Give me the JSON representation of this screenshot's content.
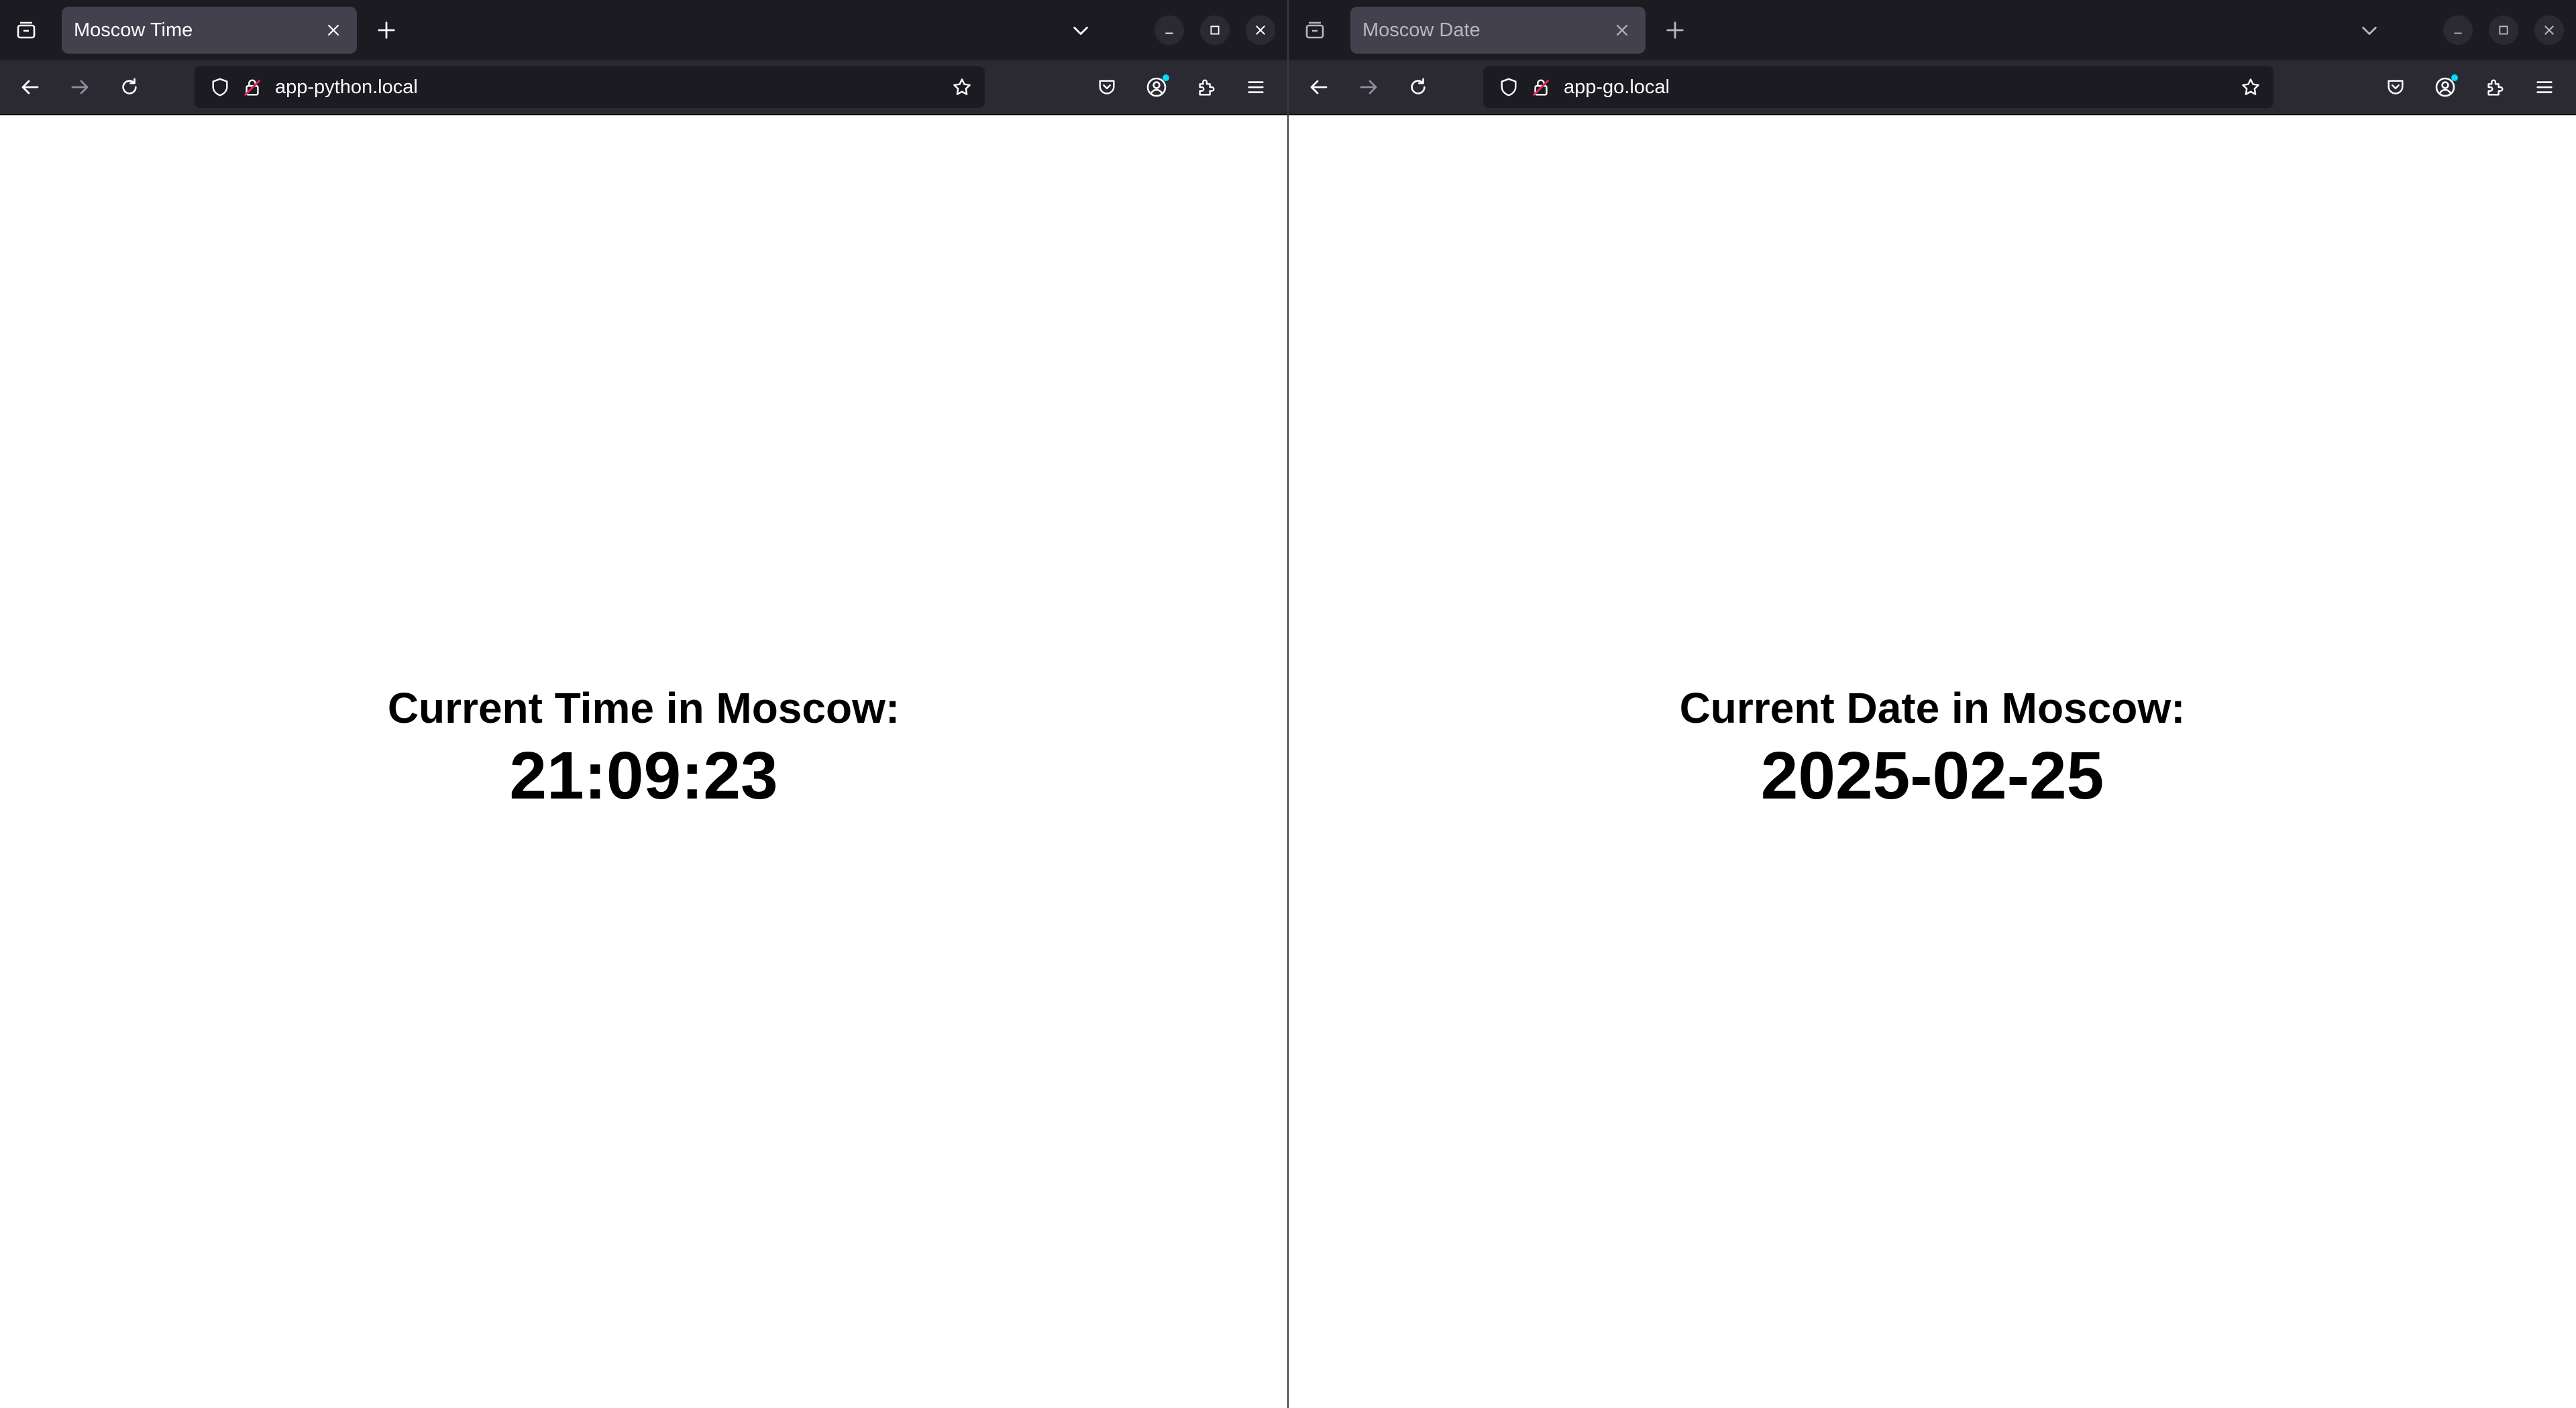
{
  "colors": {
    "tabstrip_bg": "#1c1b22",
    "toolbar_bg": "#2b2a33",
    "active_tab_bg": "#42414d",
    "urlbar_bg": "#1c1b22",
    "text_light": "#fbfbfe",
    "page_bg": "#ffffff",
    "page_text": "#000000",
    "lock_warning": "#e22850",
    "account_badge": "#00ddff"
  },
  "windows": [
    {
      "tab": {
        "title": "Moscow Time",
        "close_icon": "close-icon"
      },
      "toolbar": {
        "url": "app-python.local"
      },
      "page": {
        "heading": "Current Time in Moscow:",
        "value": "21:09:23"
      }
    },
    {
      "tab": {
        "title": "Moscow Date",
        "close_icon": "close-icon"
      },
      "toolbar": {
        "url": "app-go.local"
      },
      "page": {
        "heading": "Current Date in Moscow:",
        "value": "2025-02-25"
      }
    }
  ],
  "icons": {
    "tab_overview": "tab-overview-icon",
    "new_tab": "plus-icon",
    "list_all_tabs": "chevron-down-icon",
    "minimize": "minimize-icon",
    "maximize": "maximize-icon",
    "close_window": "close-icon",
    "back": "back-arrow-icon",
    "forward": "forward-arrow-icon",
    "reload": "reload-icon",
    "tracking_protection": "shield-icon",
    "site_security": "lock-icon",
    "bookmark": "star-icon",
    "pocket": "pocket-icon",
    "account": "account-icon",
    "extensions": "puzzle-icon",
    "menu": "hamburger-menu-icon"
  }
}
